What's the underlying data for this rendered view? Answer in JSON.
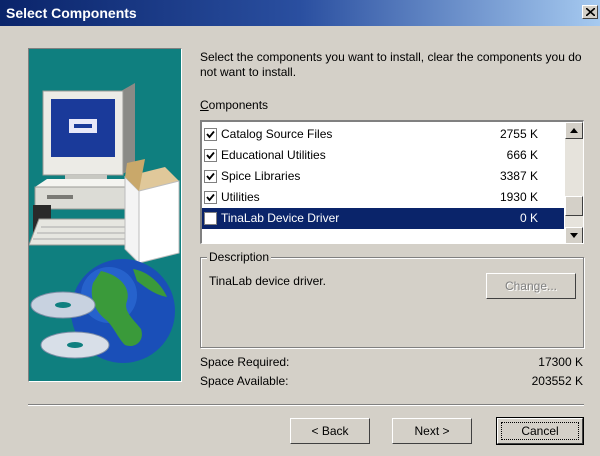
{
  "window": {
    "title": "Select Components"
  },
  "instruction": "Select the components you want to install, clear the components you do not want to install.",
  "components": {
    "label": "Components",
    "items": [
      {
        "name": "Catalog Source Files",
        "size": "2755 K",
        "checked": true
      },
      {
        "name": "Educational Utilities",
        "size": "666 K",
        "checked": true
      },
      {
        "name": "Spice Libraries",
        "size": "3387 K",
        "checked": true
      },
      {
        "name": "Utilities",
        "size": "1930 K",
        "checked": true
      },
      {
        "name": "TinaLab Device Driver",
        "size": "0 K",
        "checked": false,
        "selected": true
      }
    ]
  },
  "description": {
    "legend": "Description",
    "text": "TinaLab device driver.",
    "change_label": "Change..."
  },
  "space": {
    "required_label": "Space Required:",
    "required_value": "17300 K",
    "available_label": "Space Available:",
    "available_value": "203552 K"
  },
  "buttons": {
    "back": "< Back",
    "next": "Next >",
    "cancel": "Cancel"
  },
  "colors": {
    "title_bar": "#0a246a",
    "selection": "#0a246a",
    "art_background": "#0f7f7f",
    "face": "#d4d0c8"
  }
}
